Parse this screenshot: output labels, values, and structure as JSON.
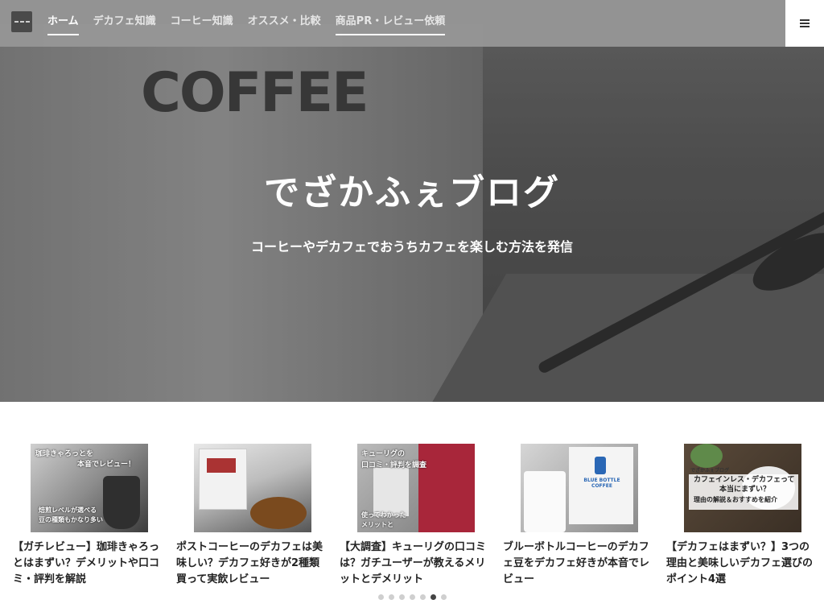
{
  "header": {
    "nav": [
      {
        "label": "ホーム"
      },
      {
        "label": "デカフェ知識"
      },
      {
        "label": "コーヒー知識"
      },
      {
        "label": "オススメ・比較"
      },
      {
        "label": "商品PR・レビュー依頼"
      }
    ],
    "menu_icon": "hamburger-icon"
  },
  "hero": {
    "mug_text": "COFFEE",
    "title": "でざかふぇブログ",
    "subtitle": "コーヒーやデカフェでおうちカフェを楽しむ方法を発信"
  },
  "posts": [
    {
      "title": "【ガチレビュー】珈琲きゃろっとはまずい？デメリットや口コミ・評判を解説",
      "thumb_text": [
        "珈琲きゃろっとを",
        "本音でレビュー！",
        "焙煎レベルが選べる",
        "豆の種類もかなり多い"
      ]
    },
    {
      "title": "ポストコーヒーのデカフェは美味しい？デカフェ好きが2種類買って実飲レビュー",
      "thumb_text": []
    },
    {
      "title": "【大調査】キューリグの口コミは？ガチユーザーが教えるメリットとデメリット",
      "thumb_text": [
        "キューリグの",
        "口コミ・評判を調査",
        "使ってわかった",
        "メリットと"
      ]
    },
    {
      "title": "ブルーボトルコーヒーのデカフェ豆をデカフェ好きが本音でレビュー",
      "thumb_text": [
        "BLUE BOTTLE",
        "COFFEE"
      ]
    },
    {
      "title": "【デカフェはまずい？】3つの理由と美味しいデカフェ選びのポイント4選",
      "thumb_text": [
        "でざかふぇブログ",
        "カフェインレス・デカフェって",
        "本当にまずい？",
        "理由の解説＆おすすめを紹介"
      ]
    }
  ],
  "slider": {
    "count": 7,
    "active": 5
  }
}
